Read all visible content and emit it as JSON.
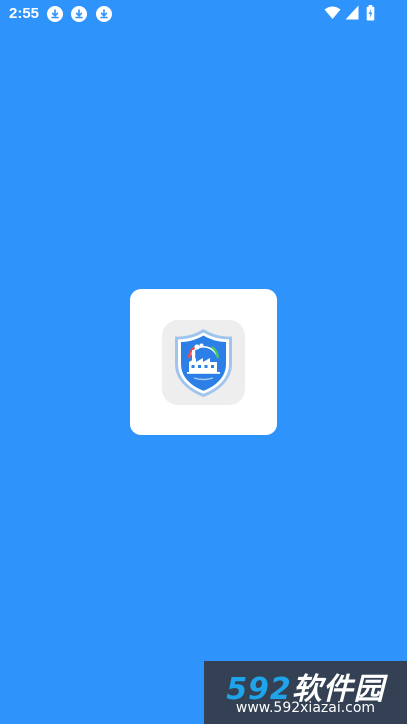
{
  "status_bar": {
    "time": "2:55",
    "notification_icons": [
      "download-icon",
      "download-icon",
      "download-icon"
    ],
    "system_icons": [
      "wifi-icon",
      "cellular-signal-icon",
      "battery-charging-icon"
    ]
  },
  "splash": {
    "app_icon": "shield-factory-logo-icon",
    "background_color": "#2e93fb",
    "card_color": "#ffffff"
  },
  "watermark": {
    "brand_number": "592",
    "brand_text": "软件园",
    "url": "www.592xiazai.com"
  }
}
